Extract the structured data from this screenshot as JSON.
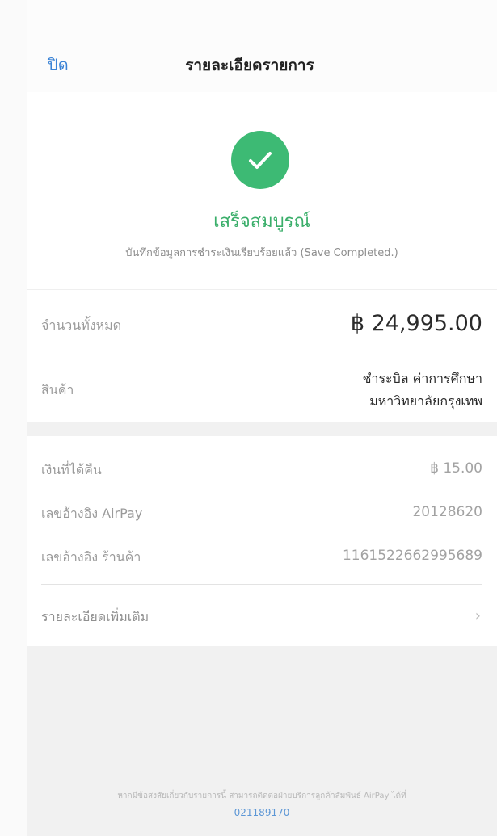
{
  "header": {
    "close_label": "ปิด",
    "title": "รายละเอียดรายการ"
  },
  "status": {
    "icon": "check-icon",
    "title": "เสร็จสมบูรณ์",
    "subtitle": "บันทึกข้อมูลการชำระเงินเรียบร้อยแล้ว (Save Completed.)",
    "color": "#3dba74"
  },
  "summary": {
    "amount_label": "จำนวนทั้งหมด",
    "amount_value": "฿ 24,995.00",
    "product_label": "สินค้า",
    "product_line1": "ชำระบิล ค่าการศึกษา",
    "product_line2": "มหาวิทยาลัยกรุงเทพ"
  },
  "details": {
    "cashback_label": "เงินที่ได้คืน",
    "cashback_value": "฿ 15.00",
    "airpay_ref_label": "เลขอ้างอิง AirPay",
    "airpay_ref_value": "20128620",
    "merchant_ref_label": "เลขอ้างอิง ร้านค้า",
    "merchant_ref_value": "1161522662995689",
    "more_label": "รายละเอียดเพิ่มเติม"
  },
  "footer": {
    "note": "หากมีข้อสงสัยเกี่ยวกับรายการนี้ สามารถติดต่อฝ่ายบริการลูกค้าสัมพันธ์ AirPay ได้ที่",
    "phone": "021189170"
  }
}
